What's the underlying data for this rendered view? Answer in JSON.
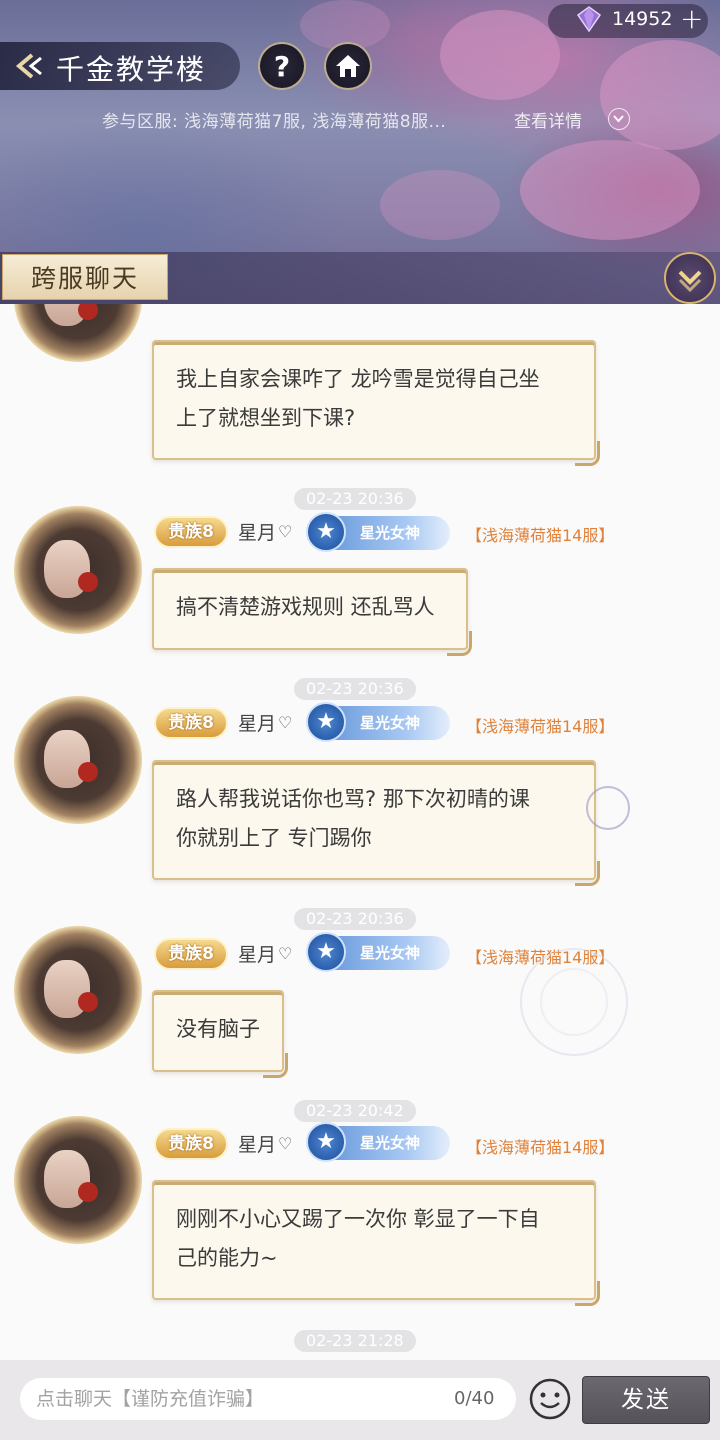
{
  "header": {
    "gem_count": "14952",
    "plus_label": "+",
    "title": "千金教学楼",
    "help_label": "?",
    "servers": "参与区服: 浅海薄荷猫7服, 浅海薄荷猫8服...",
    "details_label": "查看详情",
    "active_tab": "跨服聊天"
  },
  "chat": {
    "first_message": "我上自家会课咋了 龙吟雪是觉得自己坐\n上了就想坐到下课?",
    "messages": [
      {
        "time": "02-23 20:36",
        "badge": "贵族8",
        "nick": "星月",
        "nick_icon": "♡",
        "title": "星光女神",
        "server": "【浅海薄荷猫14服】",
        "text": "搞不清楚游戏规则 还乱骂人"
      },
      {
        "time": "02-23 20:36",
        "badge": "贵族8",
        "nick": "星月",
        "nick_icon": "♡",
        "title": "星光女神",
        "server": "【浅海薄荷猫14服】",
        "text": "路人帮我说话你也骂? 那下次初晴的课\n你就别上了 专门踢你"
      },
      {
        "time": "02-23 20:36",
        "badge": "贵族8",
        "nick": "星月",
        "nick_icon": "♡",
        "title": "星光女神",
        "server": "【浅海薄荷猫14服】",
        "text": "没有脑子"
      },
      {
        "time": "02-23 20:42",
        "badge": "贵族8",
        "nick": "星月",
        "nick_icon": "♡",
        "title": "星光女神",
        "server": "【浅海薄荷猫14服】",
        "text": "刚刚不小心又踢了一次你 彰显了一下自\n己的能力~"
      }
    ],
    "last_time": "02-23 21:28"
  },
  "input": {
    "placeholder": "点击聊天【谨防充值诈骗】",
    "counter": "0/40",
    "send_label": "发送"
  }
}
